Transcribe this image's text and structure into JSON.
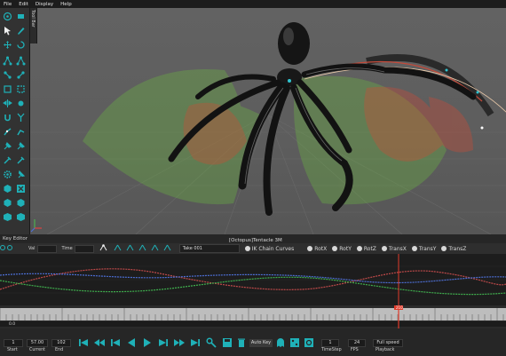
{
  "menu": [
    "File",
    "Edit",
    "Display",
    "Help"
  ],
  "tool_tab_label": "Tool Bar",
  "viewport": {
    "title": "[Octopus]Tentacle 3M"
  },
  "key_editor": {
    "title": "Key Editor",
    "val_label": "Val",
    "time_label": "Time",
    "take_selected": "Take 001",
    "ik_chain_label": "IK Chain Curves",
    "channels": [
      "RotX",
      "RotY",
      "RotZ",
      "TransX",
      "TransY",
      "TransZ"
    ]
  },
  "timeline": {
    "current_frame": "0",
    "frame_count_label": "210",
    "scrubber_left": "0.0"
  },
  "bottom": {
    "start_value": "1",
    "current_value": "57.00",
    "end_value": "102",
    "start_label": "Start",
    "current_label": "Current",
    "end_label": "End",
    "auto_key_label": "Auto Key",
    "time_step_value": "1",
    "fps_value": "24",
    "playback_value": "Full speed",
    "time_step_label": "TimeStep",
    "fps_label": "FPS",
    "playback_label": "Playback"
  },
  "colors": {
    "accent": "#1fb1b8",
    "red_marker": "#e03a2a",
    "curve_red": "#c14a4a",
    "curve_green": "#3fae4d",
    "curve_blue": "#4d6fd6"
  }
}
